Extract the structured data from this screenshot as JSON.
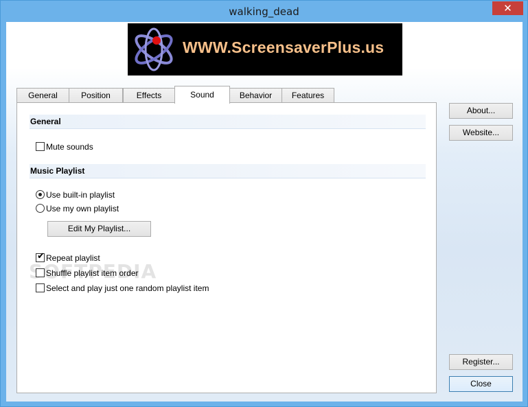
{
  "window": {
    "title": "walking_dead",
    "close_glyph": "✕"
  },
  "banner": {
    "text": "WWW.ScreensaverPlus.us",
    "logo_icon": "atom-logo-icon"
  },
  "tabs": [
    {
      "label": "General"
    },
    {
      "label": "Position"
    },
    {
      "label": "Effects"
    },
    {
      "label": "Sound",
      "active": true
    },
    {
      "label": "Behavior"
    },
    {
      "label": "Features"
    }
  ],
  "panel": {
    "general_header": "General",
    "mute_sounds": {
      "label": "Mute sounds",
      "checked": false
    },
    "playlist_header": "Music Playlist",
    "radio_builtin": {
      "label": "Use built-in playlist",
      "selected": true
    },
    "radio_own": {
      "label": "Use my own playlist",
      "selected": false
    },
    "edit_playlist_button": "Edit My Playlist...",
    "repeat_playlist": {
      "label": "Repeat playlist",
      "checked": true
    },
    "shuffle_playlist": {
      "label": "Shuffle playlist item order",
      "checked": false
    },
    "random_one": {
      "label": "Select and play just one random playlist item",
      "checked": false
    },
    "watermark": "SOFTPEDIA"
  },
  "side_buttons": {
    "about": "About...",
    "website": "Website...",
    "register": "Register...",
    "close": "Close"
  },
  "colors": {
    "titlebar": "#6cb2ea",
    "close_button": "#c7403a",
    "banner_text": "#f7c08a"
  }
}
